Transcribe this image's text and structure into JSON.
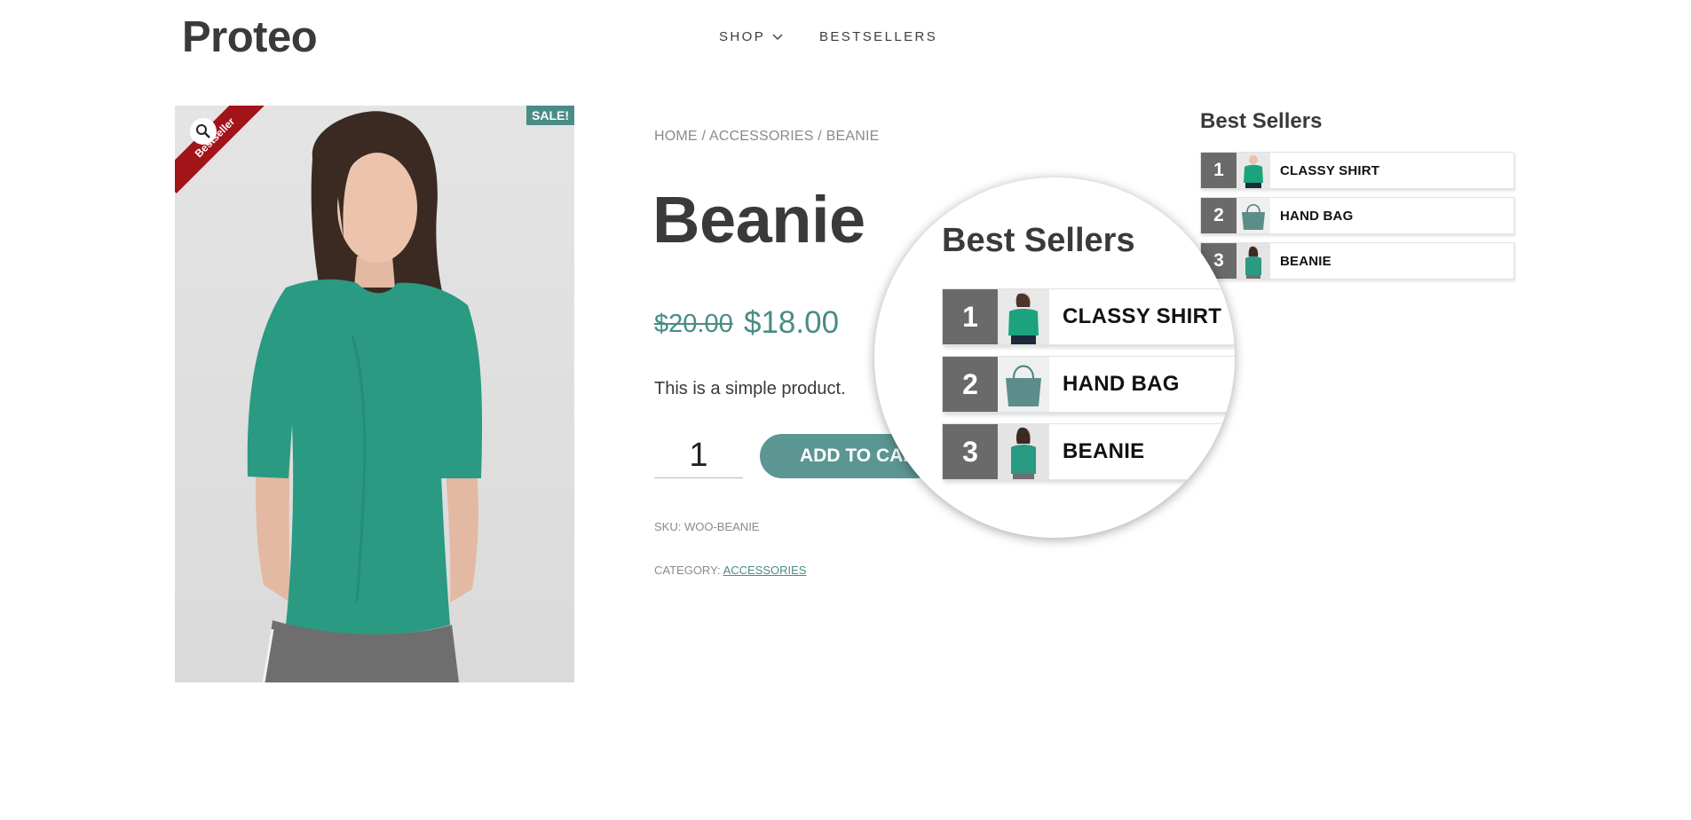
{
  "header": {
    "logo": "Proteo",
    "nav": {
      "shop_label": "SHOP",
      "bestsellers_label": "BESTSELLERS"
    }
  },
  "product": {
    "image_ribbon": "Bestseller",
    "sale_badge": "SALE!",
    "breadcrumb": "HOME / ACCESSORIES / BEANIE",
    "title": "Beanie",
    "price_old": "$20.00",
    "price_new": "$18.00",
    "description": "This is a simple product.",
    "quantity": "1",
    "add_to_cart_label": "ADD TO CART",
    "sku_label": "SKU:",
    "sku_value": "WOO-BEANIE",
    "category_label": "CATEGORY:",
    "category_value": "ACCESSORIES"
  },
  "sidebar": {
    "widget_title": "Best Sellers",
    "items": [
      {
        "rank": "1",
        "name": "CLASSY SHIRT",
        "thumb": "green-shirt-thumb"
      },
      {
        "rank": "2",
        "name": "HAND BAG",
        "thumb": "teal-handbag-thumb"
      },
      {
        "rank": "3",
        "name": "BEANIE",
        "thumb": "teal-top-thumb"
      }
    ]
  },
  "colors": {
    "accent": "#4a8c86",
    "button": "#5b9692",
    "ribbon": "#a3141a",
    "rank_bg": "#6a6a6a",
    "product_green": "#2a9a82"
  },
  "icons": {
    "nav_dropdown": "chevron-down-icon",
    "image_zoom": "magnifier-icon"
  }
}
